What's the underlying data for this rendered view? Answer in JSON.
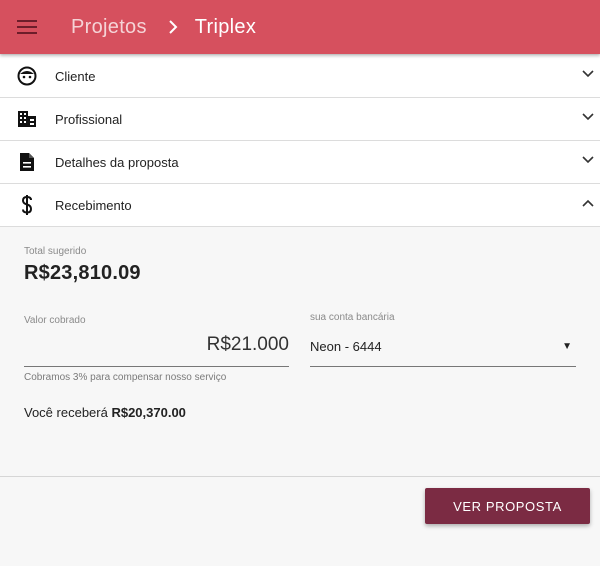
{
  "header": {
    "parent": "Projetos",
    "current": "Triplex",
    "bg_color": "#d6505e"
  },
  "sections": [
    {
      "label": "Cliente",
      "icon": "face-icon",
      "expanded": false
    },
    {
      "label": "Profissional",
      "icon": "business-icon",
      "expanded": false
    },
    {
      "label": "Detalhes da proposta",
      "icon": "description-icon",
      "expanded": false
    },
    {
      "label": "Recebimento",
      "icon": "dollar-icon",
      "expanded": true
    }
  ],
  "receipt": {
    "total_label": "Total sugerido",
    "total_value": "R$23,810.09",
    "charged_label": "Valor cobrado",
    "charged_value": "R$21.000",
    "charged_hint": "Cobramos 3% para compensar nosso serviço",
    "account_label": "sua conta bancária",
    "account_value": "Neon - 6444",
    "receive_prefix": "Você receberá",
    "receive_value": "R$20,370.00"
  },
  "actions": {
    "view_proposal": "VER PROPOSTA",
    "button_color": "#7b2b43"
  }
}
